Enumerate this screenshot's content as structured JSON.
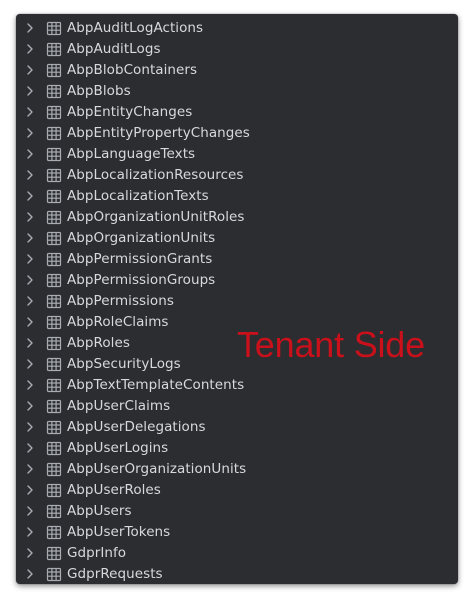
{
  "tree": {
    "items": [
      {
        "label": "AbpAuditLogActions"
      },
      {
        "label": "AbpAuditLogs"
      },
      {
        "label": "AbpBlobContainers"
      },
      {
        "label": "AbpBlobs"
      },
      {
        "label": "AbpEntityChanges"
      },
      {
        "label": "AbpEntityPropertyChanges"
      },
      {
        "label": "AbpLanguageTexts"
      },
      {
        "label": "AbpLocalizationResources"
      },
      {
        "label": "AbpLocalizationTexts"
      },
      {
        "label": "AbpOrganizationUnitRoles"
      },
      {
        "label": "AbpOrganizationUnits"
      },
      {
        "label": "AbpPermissionGrants"
      },
      {
        "label": "AbpPermissionGroups"
      },
      {
        "label": "AbpPermissions"
      },
      {
        "label": "AbpRoleClaims"
      },
      {
        "label": "AbpRoles"
      },
      {
        "label": "AbpSecurityLogs"
      },
      {
        "label": "AbpTextTemplateContents"
      },
      {
        "label": "AbpUserClaims"
      },
      {
        "label": "AbpUserDelegations"
      },
      {
        "label": "AbpUserLogins"
      },
      {
        "label": "AbpUserOrganizationUnits"
      },
      {
        "label": "AbpUserRoles"
      },
      {
        "label": "AbpUsers"
      },
      {
        "label": "AbpUserTokens"
      },
      {
        "label": "GdprInfo"
      },
      {
        "label": "GdprRequests"
      }
    ],
    "chevron_icon": "chevron-right-icon",
    "table_icon": "table-icon"
  },
  "annotation": {
    "text": "Tenant Side",
    "color": "#c9101b"
  },
  "colors": {
    "background": "#2b2d30",
    "text": "#d8d9dc",
    "icon": "#a9adb3"
  }
}
